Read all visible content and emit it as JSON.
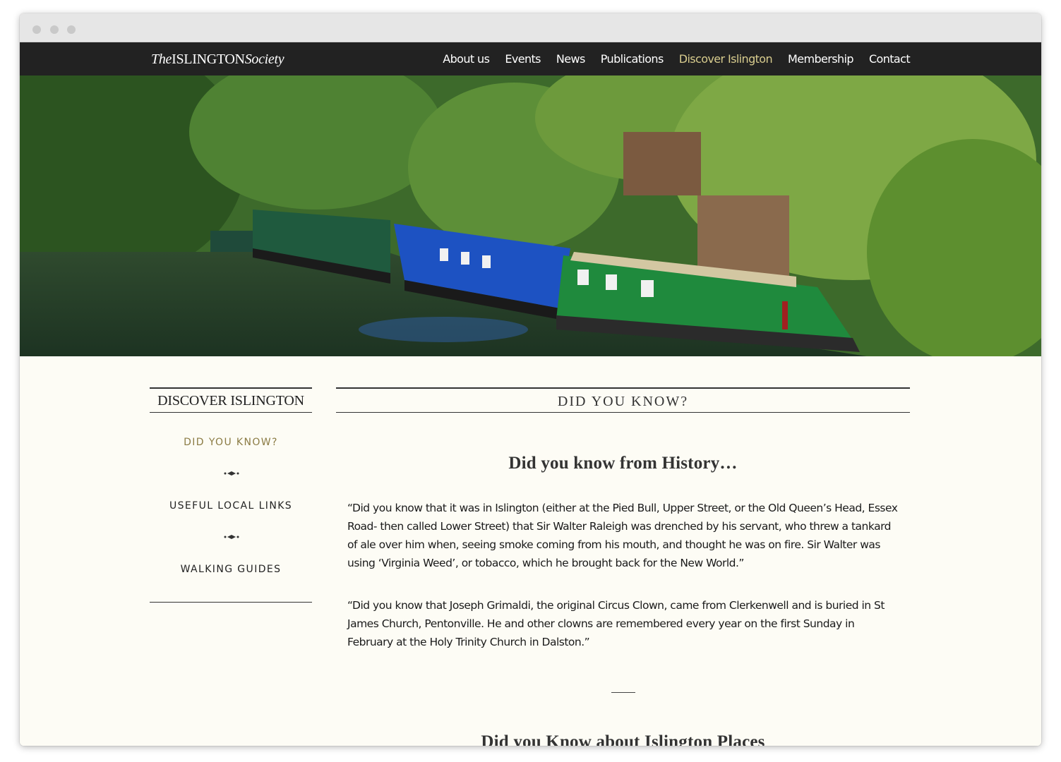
{
  "site": {
    "logo_prefix": "The",
    "logo_main": "ISLINGTON",
    "logo_suffix": "Society"
  },
  "nav": {
    "items": [
      {
        "label": "About us"
      },
      {
        "label": "Events"
      },
      {
        "label": "News"
      },
      {
        "label": "Publications"
      },
      {
        "label": "Discover Islington",
        "active": true
      },
      {
        "label": "Membership"
      },
      {
        "label": "Contact"
      }
    ]
  },
  "hero": {
    "icon": "canal-boats-photo"
  },
  "sidebar": {
    "title": "DISCOVER ISLINGTON",
    "links": [
      {
        "label": "DID YOU KNOW?",
        "active": true
      },
      {
        "label": "USEFUL LOCAL LINKS"
      },
      {
        "label": "WALKING GUIDES"
      }
    ]
  },
  "main": {
    "title": "DID YOU KNOW?",
    "heading": "Did you know from History…",
    "paragraphs": [
      "“Did you know that it was in Islington (either at the Pied Bull, Upper Street, or the Old Queen’s Head, Essex Road- then called Lower Street) that Sir Walter Raleigh was drenched by his servant, who threw a tankard of ale over him when, seeing smoke coming from his mouth, and thought he was on fire. Sir Walter was using ‘Virginia Weed’, or tobacco, which he brought back for the New World.”",
      "“Did you know that Joseph Grimaldi, the original Circus Clown, came from Clerkenwell and is buried in St James Church, Pentonville. He and other clowns are remembered every year on the first Sunday in February at the Holy Trinity Church in Dalston.”"
    ],
    "next_heading": "Did you Know about Islington Places"
  },
  "colors": {
    "header_bg": "#222222",
    "active_nav": "#d8cc8e",
    "active_side": "#8b7b44",
    "page_bg": "#fdfcf5"
  }
}
